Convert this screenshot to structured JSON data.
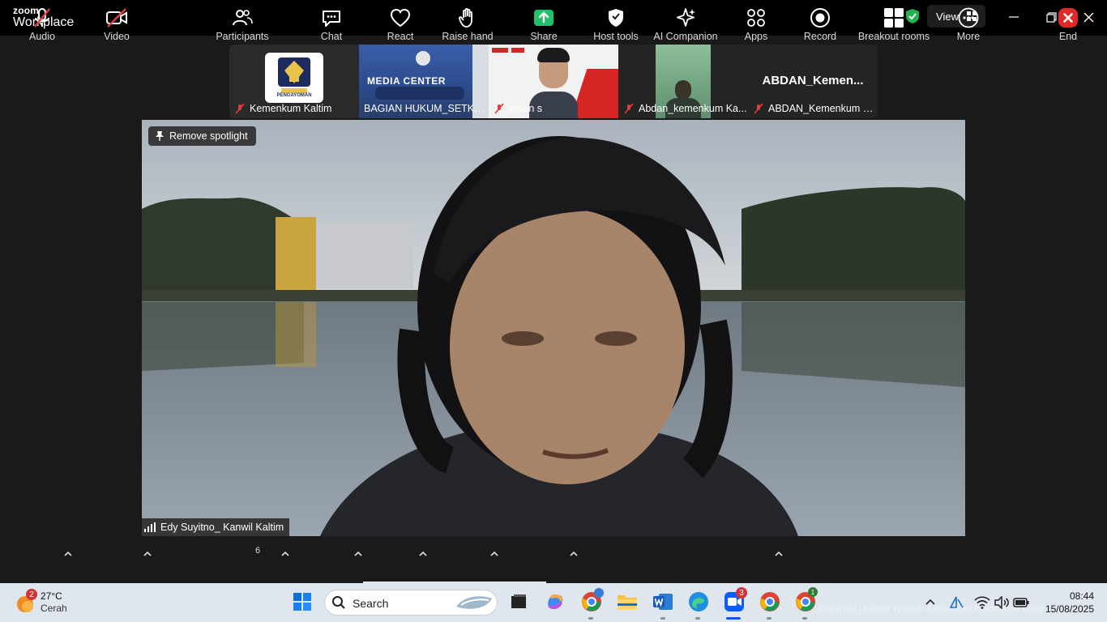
{
  "app": {
    "logo_line1": "zoom",
    "logo_line2": "Workplace",
    "view_label": "View"
  },
  "thumbnails": [
    {
      "name": "Kemenkum Kaltim"
    },
    {
      "name": "BAGIAN HUKUM_SETKA..."
    },
    {
      "name": "ervan s"
    },
    {
      "name": "Abdan_kemenkum Ka..."
    },
    {
      "name": "ABDAN_Kemenkum K...",
      "display_name": "ABDAN_Kemen..."
    }
  ],
  "thumb_texts": {
    "logo_text": "PENGAYOMAN",
    "media_center": "MEDIA CENTER"
  },
  "spotlight": {
    "remove_label": "Remove spotlight",
    "name": "Edy Suyitno_ Kanwil Kaltim"
  },
  "toolbar": {
    "audio": "Audio",
    "video": "Video",
    "participants": "Participants",
    "participant_count": "6",
    "chat": "Chat",
    "react": "React",
    "raise_hand": "Raise hand",
    "share": "Share",
    "host_tools": "Host tools",
    "ai_companion": "AI Companion",
    "apps": "Apps",
    "record": "Record",
    "breakout": "Breakout rooms",
    "more": "More",
    "end": "End"
  },
  "taskbar": {
    "weather_badge": "2",
    "temperature": "27°C",
    "condition": "Cerah",
    "search_placeholder": "Search",
    "zoom_badge": "3",
    "chrome_badge": "1",
    "time": "08:44",
    "date": "15/08/2025",
    "watermark": "Copyright | Kantor Wilayah Kemenkum Kalimantan Timur"
  },
  "colors": {
    "accent_green": "#22b14c",
    "share_green": "#1fc16b",
    "end_red": "#e02828",
    "mute_red": "#e23e3e"
  }
}
